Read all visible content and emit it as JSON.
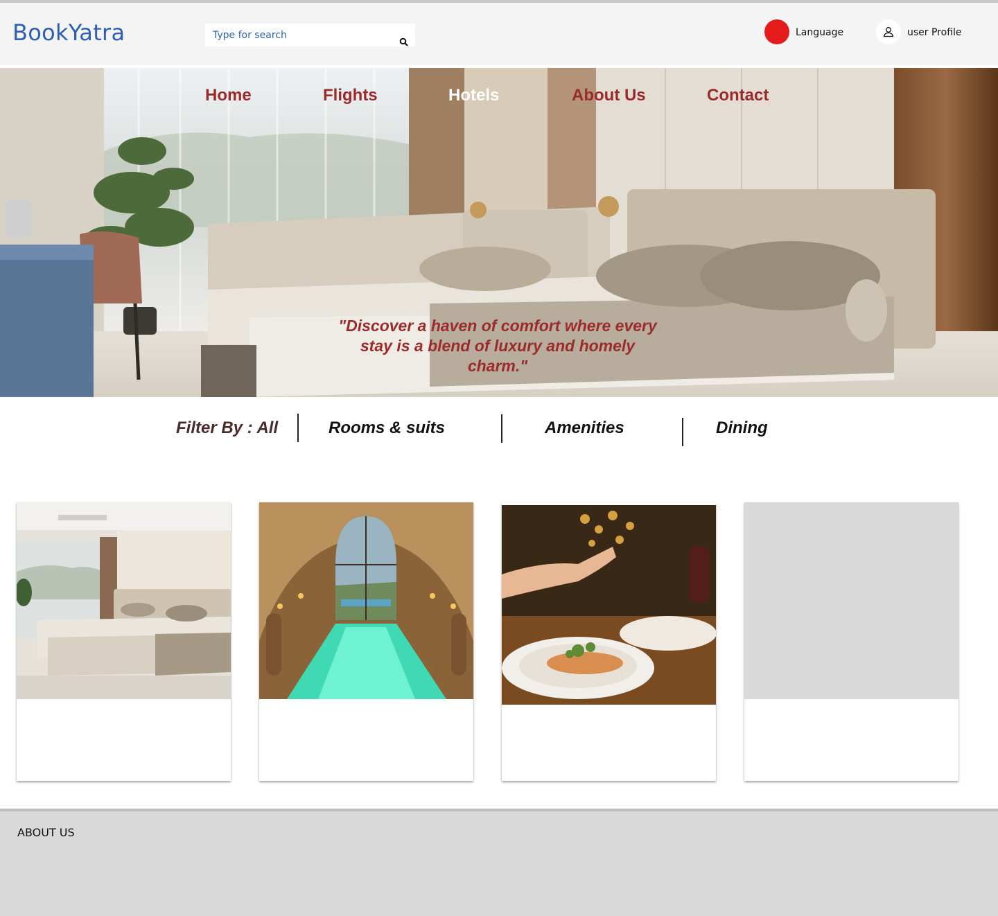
{
  "header": {
    "logo": "BookYatra",
    "search_placeholder": "Type for search",
    "language_label": "Language",
    "profile_label": "user Profile",
    "language_color": "#e51b1b"
  },
  "nav": {
    "items": [
      "Home",
      "Flights",
      "Hotels",
      "About Us",
      "Contact"
    ],
    "active": "Hotels"
  },
  "hero": {
    "quote": "\"Discover a haven of comfort  where every stay is a blend of luxury and homely charm.\""
  },
  "filter": {
    "label": "Filter By : All",
    "tabs": [
      "Rooms & suits",
      "Amenities",
      "Dining"
    ]
  },
  "cards": [
    {
      "image": "hotel-room"
    },
    {
      "image": "indoor-pool"
    },
    {
      "image": "dining-plate"
    },
    {
      "image": "placeholder"
    }
  ],
  "footer": {
    "title": "ABOUT US"
  },
  "colors": {
    "brand_blue": "#2d5fb3",
    "nav_red": "#9b2b2b",
    "footer_gray": "#d9d9d9"
  }
}
